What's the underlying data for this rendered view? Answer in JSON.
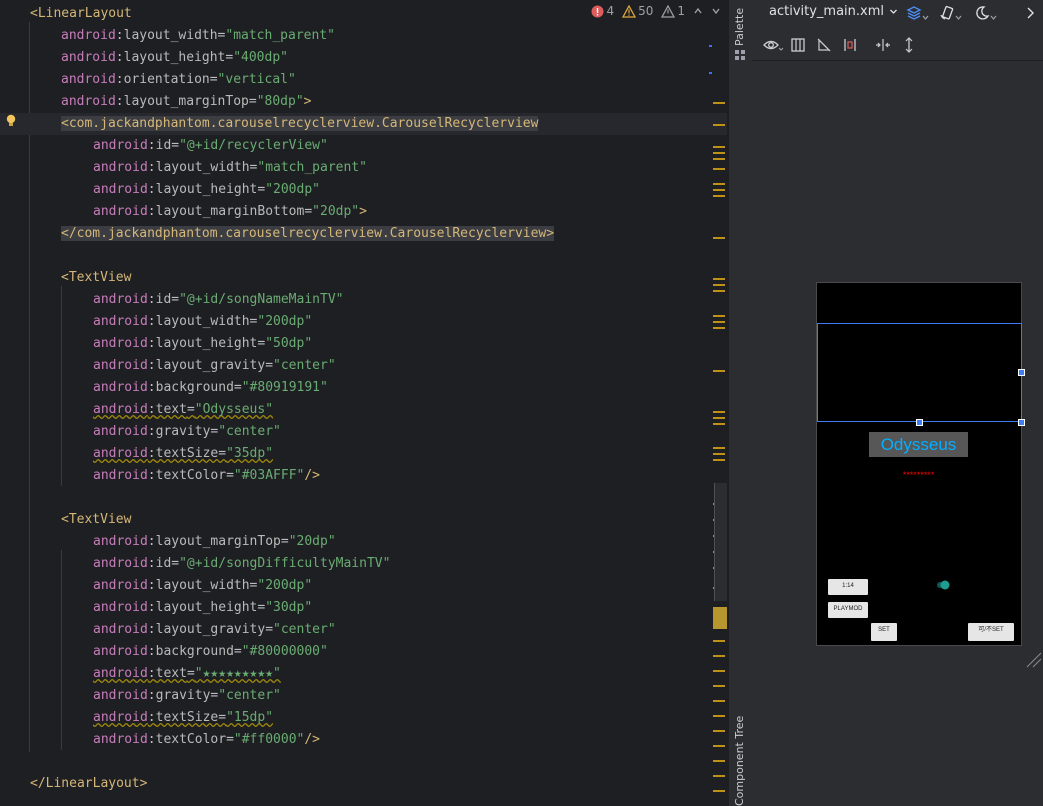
{
  "editor": {
    "inspections": {
      "errors": "4",
      "warnings": "50",
      "weak_warnings": "1"
    },
    "lines": [
      {
        "indent": 0,
        "segs": [
          [
            "c-tag",
            "<LinearLayout"
          ]
        ]
      },
      {
        "indent": 1,
        "segs": [
          [
            "c-ns",
            "android"
          ],
          [
            "c-punc",
            ":"
          ],
          [
            "c-attr",
            "layout_width"
          ],
          [
            "c-punc",
            "="
          ],
          [
            "c-str",
            "\"match_parent\""
          ]
        ]
      },
      {
        "indent": 1,
        "segs": [
          [
            "c-ns",
            "android"
          ],
          [
            "c-punc",
            ":"
          ],
          [
            "c-attr",
            "layout_height"
          ],
          [
            "c-punc",
            "="
          ],
          [
            "c-str",
            "\"400dp\""
          ]
        ]
      },
      {
        "indent": 1,
        "segs": [
          [
            "c-ns",
            "android"
          ],
          [
            "c-punc",
            ":"
          ],
          [
            "c-attr",
            "orientation"
          ],
          [
            "c-punc",
            "="
          ],
          [
            "c-str",
            "\"vertical\""
          ]
        ]
      },
      {
        "indent": 1,
        "segs": [
          [
            "c-ns",
            "android"
          ],
          [
            "c-punc",
            ":"
          ],
          [
            "c-attr",
            "layout_marginTop"
          ],
          [
            "c-punc",
            "="
          ],
          [
            "c-str",
            "\"80dp\""
          ],
          [
            "c-tag",
            ">"
          ]
        ]
      },
      {
        "indent": 1,
        "hl": true,
        "segs": [
          [
            "tag-bg",
            "<com.jackandphantom.carouselrecyclerview.CarouselRecyclerview"
          ]
        ]
      },
      {
        "indent": 2,
        "segs": [
          [
            "c-ns",
            "android"
          ],
          [
            "c-punc",
            ":"
          ],
          [
            "c-attr",
            "id"
          ],
          [
            "c-punc",
            "="
          ],
          [
            "c-str",
            "\"@+id/recyclerView\""
          ]
        ]
      },
      {
        "indent": 2,
        "segs": [
          [
            "c-ns",
            "android"
          ],
          [
            "c-punc",
            ":"
          ],
          [
            "c-attr",
            "layout_width"
          ],
          [
            "c-punc",
            "="
          ],
          [
            "c-str",
            "\"match_parent\""
          ]
        ]
      },
      {
        "indent": 2,
        "segs": [
          [
            "c-ns",
            "android"
          ],
          [
            "c-punc",
            ":"
          ],
          [
            "c-attr",
            "layout_height"
          ],
          [
            "c-punc",
            "="
          ],
          [
            "c-str",
            "\"200dp\""
          ]
        ]
      },
      {
        "indent": 2,
        "segs": [
          [
            "c-ns",
            "android"
          ],
          [
            "c-punc",
            ":"
          ],
          [
            "c-attr",
            "layout_marginBottom"
          ],
          [
            "c-punc",
            "="
          ],
          [
            "c-str",
            "\"20dp\""
          ],
          [
            "c-tag",
            ">"
          ]
        ]
      },
      {
        "indent": 1,
        "segs": [
          [
            "tag-bg",
            "</com.jackandphantom.carouselrecyclerview.CarouselRecyclerview>"
          ]
        ]
      },
      {
        "indent": 0,
        "segs": []
      },
      {
        "indent": 1,
        "segs": [
          [
            "c-tag",
            "<TextView"
          ]
        ]
      },
      {
        "indent": 2,
        "segs": [
          [
            "c-ns",
            "android"
          ],
          [
            "c-punc",
            ":"
          ],
          [
            "c-attr",
            "id"
          ],
          [
            "c-punc",
            "="
          ],
          [
            "c-str",
            "\"@+id/songNameMainTV\""
          ]
        ]
      },
      {
        "indent": 2,
        "segs": [
          [
            "c-ns",
            "android"
          ],
          [
            "c-punc",
            ":"
          ],
          [
            "c-attr",
            "layout_width"
          ],
          [
            "c-punc",
            "="
          ],
          [
            "c-str",
            "\"200dp\""
          ]
        ]
      },
      {
        "indent": 2,
        "segs": [
          [
            "c-ns",
            "android"
          ],
          [
            "c-punc",
            ":"
          ],
          [
            "c-attr",
            "layout_height"
          ],
          [
            "c-punc",
            "="
          ],
          [
            "c-str",
            "\"50dp\""
          ]
        ]
      },
      {
        "indent": 2,
        "segs": [
          [
            "c-ns",
            "android"
          ],
          [
            "c-punc",
            ":"
          ],
          [
            "c-attr",
            "layout_gravity"
          ],
          [
            "c-punc",
            "="
          ],
          [
            "c-str",
            "\"center\""
          ]
        ]
      },
      {
        "indent": 2,
        "segs": [
          [
            "c-ns",
            "android"
          ],
          [
            "c-punc",
            ":"
          ],
          [
            "c-attr",
            "background"
          ],
          [
            "c-punc",
            "="
          ],
          [
            "c-str",
            "\"#80919191\""
          ]
        ]
      },
      {
        "indent": 2,
        "wavy": true,
        "segs": [
          [
            "c-ns",
            "android"
          ],
          [
            "c-punc",
            ":"
          ],
          [
            "c-attr",
            "text"
          ],
          [
            "c-punc",
            "="
          ],
          [
            "c-str",
            "\"Odysseus\""
          ]
        ]
      },
      {
        "indent": 2,
        "segs": [
          [
            "c-ns",
            "android"
          ],
          [
            "c-punc",
            ":"
          ],
          [
            "c-attr",
            "gravity"
          ],
          [
            "c-punc",
            "="
          ],
          [
            "c-str",
            "\"center\""
          ]
        ]
      },
      {
        "indent": 2,
        "wavy": true,
        "segs": [
          [
            "c-ns",
            "android"
          ],
          [
            "c-punc",
            ":"
          ],
          [
            "c-attr",
            "textSize"
          ],
          [
            "c-punc",
            "="
          ],
          [
            "c-str",
            "\"35dp\""
          ]
        ]
      },
      {
        "indent": 2,
        "segs": [
          [
            "c-ns",
            "android"
          ],
          [
            "c-punc",
            ":"
          ],
          [
            "c-attr",
            "textColor"
          ],
          [
            "c-punc",
            "="
          ],
          [
            "c-str",
            "\"#03AFFF\""
          ],
          [
            "c-tag",
            "/>"
          ]
        ]
      },
      {
        "indent": 0,
        "segs": []
      },
      {
        "indent": 1,
        "segs": [
          [
            "c-tag",
            "<TextView"
          ]
        ]
      },
      {
        "indent": 2,
        "segs": [
          [
            "c-ns",
            "android"
          ],
          [
            "c-punc",
            ":"
          ],
          [
            "c-attr",
            "layout_marginTop"
          ],
          [
            "c-punc",
            "="
          ],
          [
            "c-str",
            "\"20dp\""
          ]
        ]
      },
      {
        "indent": 2,
        "segs": [
          [
            "c-ns",
            "android"
          ],
          [
            "c-punc",
            ":"
          ],
          [
            "c-attr",
            "id"
          ],
          [
            "c-punc",
            "="
          ],
          [
            "c-str",
            "\"@+id/songDifficultyMainTV\""
          ]
        ]
      },
      {
        "indent": 2,
        "segs": [
          [
            "c-ns",
            "android"
          ],
          [
            "c-punc",
            ":"
          ],
          [
            "c-attr",
            "layout_width"
          ],
          [
            "c-punc",
            "="
          ],
          [
            "c-str",
            "\"200dp\""
          ]
        ]
      },
      {
        "indent": 2,
        "segs": [
          [
            "c-ns",
            "android"
          ],
          [
            "c-punc",
            ":"
          ],
          [
            "c-attr",
            "layout_height"
          ],
          [
            "c-punc",
            "="
          ],
          [
            "c-str",
            "\"30dp\""
          ]
        ]
      },
      {
        "indent": 2,
        "segs": [
          [
            "c-ns",
            "android"
          ],
          [
            "c-punc",
            ":"
          ],
          [
            "c-attr",
            "layout_gravity"
          ],
          [
            "c-punc",
            "="
          ],
          [
            "c-str",
            "\"center\""
          ]
        ]
      },
      {
        "indent": 2,
        "segs": [
          [
            "c-ns",
            "android"
          ],
          [
            "c-punc",
            ":"
          ],
          [
            "c-attr",
            "background"
          ],
          [
            "c-punc",
            "="
          ],
          [
            "c-str",
            "\"#80000000\""
          ]
        ]
      },
      {
        "indent": 2,
        "wavy": true,
        "segs": [
          [
            "c-ns",
            "android"
          ],
          [
            "c-punc",
            ":"
          ],
          [
            "c-attr",
            "text"
          ],
          [
            "c-punc",
            "="
          ],
          [
            "c-str",
            "\"★★★★★★★★★\""
          ]
        ]
      },
      {
        "indent": 2,
        "segs": [
          [
            "c-ns",
            "android"
          ],
          [
            "c-punc",
            ":"
          ],
          [
            "c-attr",
            "gravity"
          ],
          [
            "c-punc",
            "="
          ],
          [
            "c-str",
            "\"center\""
          ]
        ]
      },
      {
        "indent": 2,
        "wavy": true,
        "segs": [
          [
            "c-ns",
            "android"
          ],
          [
            "c-punc",
            ":"
          ],
          [
            "c-attr",
            "textSize"
          ],
          [
            "c-punc",
            "="
          ],
          [
            "c-str",
            "\"15dp\""
          ]
        ]
      },
      {
        "indent": 2,
        "segs": [
          [
            "c-ns",
            "android"
          ],
          [
            "c-punc",
            ":"
          ],
          [
            "c-attr",
            "textColor"
          ],
          [
            "c-punc",
            "="
          ],
          [
            "c-str",
            "\"#ff0000\""
          ],
          [
            "c-tag",
            "/>"
          ]
        ]
      },
      {
        "indent": 0,
        "segs": []
      },
      {
        "indent": 0,
        "segs": [
          [
            "c-tag",
            "</LinearLayout>"
          ]
        ]
      }
    ]
  },
  "side_strip": {
    "palette_label": "Palette",
    "component_tree_label": "Component Tree"
  },
  "design": {
    "file_name": "activity_main.xml",
    "toolbar1_icons": [
      "design-surface-icon",
      "orientation-icon",
      "night-mode-icon",
      "chevron-right-icon"
    ],
    "toolbar2_icons": [
      "eye-icon",
      "columns-icon",
      "clear-constraints-icon",
      "baseline-icon",
      "horizontal-guideline-icon",
      "vertical-guideline-icon"
    ]
  },
  "preview": {
    "song_name": "Odysseus",
    "song_difficulty": "*********",
    "song_name_color": "#03AFFF",
    "difficulty_color": "#ff0000",
    "buttons": {
      "b1": "1:14",
      "b2": "PLAYMOD",
      "b3": "SET",
      "b4": "可/不SET"
    }
  }
}
